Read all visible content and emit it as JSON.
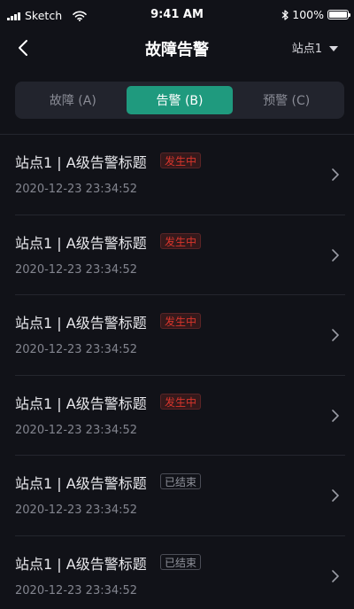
{
  "status_bar": {
    "carrier": "Sketch",
    "time": "9:41 AM",
    "battery": "100%"
  },
  "nav": {
    "title": "故障告警",
    "site_selector": "站点1"
  },
  "tabs": [
    {
      "label": "故障 (A)",
      "active": false
    },
    {
      "label": "告警 (B)",
      "active": true
    },
    {
      "label": "预警 (C)",
      "active": false
    }
  ],
  "alerts": [
    {
      "title": "站点1 | A级告警标题",
      "status": "发生中",
      "status_type": "active",
      "time": "2020-12-23 23:34:52"
    },
    {
      "title": "站点1 | A级告警标题",
      "status": "发生中",
      "status_type": "active",
      "time": "2020-12-23 23:34:52"
    },
    {
      "title": "站点1 | A级告警标题",
      "status": "发生中",
      "status_type": "active",
      "time": "2020-12-23 23:34:52"
    },
    {
      "title": "站点1 | A级告警标题",
      "status": "发生中",
      "status_type": "active",
      "time": "2020-12-23 23:34:52"
    },
    {
      "title": "站点1 | A级告警标题",
      "status": "已结束",
      "status_type": "ended",
      "time": "2020-12-23 23:34:52"
    },
    {
      "title": "站点1 | A级告警标题",
      "status": "已结束",
      "status_type": "ended",
      "time": "2020-12-23 23:34:52"
    }
  ],
  "colors": {
    "background": "#111218",
    "accent": "#1f9a7e",
    "status_active": "#d8352c",
    "status_ended": "#8f919a"
  },
  "icons": {
    "back": "chevron-left-icon",
    "dropdown": "caret-down-icon",
    "row_arrow": "chevron-right-icon"
  }
}
